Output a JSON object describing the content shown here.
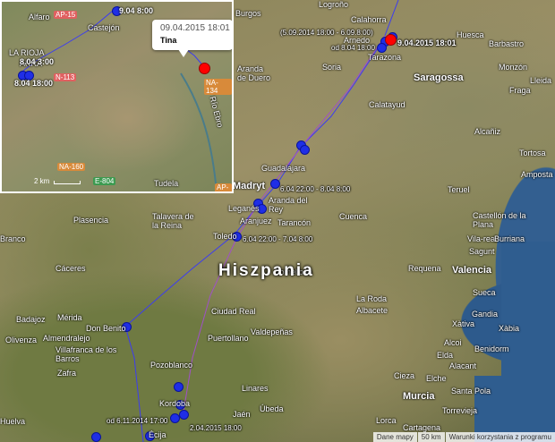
{
  "map": {
    "country_label": "Hiszpania",
    "cities": [
      {
        "name": "Burgos"
      },
      {
        "name": "Logroño"
      },
      {
        "name": "Calahorra"
      },
      {
        "name": "Arnedo"
      },
      {
        "name": "Tarazona"
      },
      {
        "name": "Huesca"
      },
      {
        "name": "Barbastro"
      },
      {
        "name": "Saragossa"
      },
      {
        "name": "Monzón"
      },
      {
        "name": "Soria"
      },
      {
        "name": "Aranda de Duero"
      },
      {
        "name": "Calatayud"
      },
      {
        "name": "Fraga"
      },
      {
        "name": "Lleida"
      },
      {
        "name": "Alcañiz"
      },
      {
        "name": "Tortosa"
      },
      {
        "name": "Amposta"
      },
      {
        "name": "Guadalajara"
      },
      {
        "name": "Madryt"
      },
      {
        "name": "Aranda del Rey"
      },
      {
        "name": "Leganés"
      },
      {
        "name": "Aranjuez"
      },
      {
        "name": "Tarancón"
      },
      {
        "name": "Cuenca"
      },
      {
        "name": "Plasencia"
      },
      {
        "name": "Talavera de la Reina"
      },
      {
        "name": "Toledo"
      },
      {
        "name": "Teruel"
      },
      {
        "name": "Castellón de la Plana"
      },
      {
        "name": "Vila-real"
      },
      {
        "name": "Burriana"
      },
      {
        "name": "Sagunt"
      },
      {
        "name": "Valencia"
      },
      {
        "name": "Cáceres"
      },
      {
        "name": "Requena"
      },
      {
        "name": "Tomelloso"
      },
      {
        "name": "La Roda"
      },
      {
        "name": "Albacete"
      },
      {
        "name": "Sueca"
      },
      {
        "name": "Gandia"
      },
      {
        "name": "Xàtiva"
      },
      {
        "name": "Alcoi"
      },
      {
        "name": "Benidorm"
      },
      {
        "name": "Xàbia"
      },
      {
        "name": "Mérida"
      },
      {
        "name": "Badajoz"
      },
      {
        "name": "Olivenza"
      },
      {
        "name": "Almendralejo"
      },
      {
        "name": "Don Benito"
      },
      {
        "name": "Ciudad Real"
      },
      {
        "name": "Puertollano"
      },
      {
        "name": "Valdepeñas"
      },
      {
        "name": "Villafranca de los Barros"
      },
      {
        "name": "Zafra"
      },
      {
        "name": "Pozoblanco"
      },
      {
        "name": "Linares"
      },
      {
        "name": "Jaén"
      },
      {
        "name": "Úbeda"
      },
      {
        "name": "Elda"
      },
      {
        "name": "Alacant"
      },
      {
        "name": "Elche"
      },
      {
        "name": "Santa Pola"
      },
      {
        "name": "Torrevieja"
      },
      {
        "name": "Murcia"
      },
      {
        "name": "Cieza"
      },
      {
        "name": "Lorca"
      },
      {
        "name": "Cartagena"
      },
      {
        "name": "Kordoba"
      },
      {
        "name": "Écija"
      },
      {
        "name": "Branco"
      },
      {
        "name": "Huelva"
      }
    ],
    "annotations": [
      {
        "text": "(5.09.2014 18:00 - 6.09.8:00)"
      },
      {
        "text": "od 8.04 18:00"
      },
      {
        "text": "9.04.2015 18:01"
      },
      {
        "text": "6.04 22:00 - 8.04 8:00"
      },
      {
        "text": "6.04 22:00 - 7.04 8:00"
      },
      {
        "text": "od 6.11.2014 17:00"
      },
      {
        "text": "2.04.2015 18:00"
      }
    ],
    "inset": {
      "labels": [
        {
          "text": "Alfaro"
        },
        {
          "text": "Castejón"
        },
        {
          "text": "9.04 8:00"
        },
        {
          "text": "LA RIOJA"
        },
        {
          "text": "ARRA"
        },
        {
          "text": "8.04 3:00"
        },
        {
          "text": "8.04 18:00"
        },
        {
          "text": "Río Ebro"
        },
        {
          "text": "Tudela"
        }
      ],
      "roads": [
        {
          "text": "AP-15",
          "color": "#e06060"
        },
        {
          "text": "N-113",
          "color": "#e06060"
        },
        {
          "text": "NA-134",
          "color": "#d88a3a"
        },
        {
          "text": "NA-160",
          "color": "#d88a3a"
        },
        {
          "text": "E-804",
          "color": "#3c9a50"
        },
        {
          "text": "AP-68",
          "color": "#d88a3a"
        }
      ],
      "scale": "2 km",
      "popup": {
        "date": "09.04.2015 18:01",
        "name": "Tina"
      }
    },
    "footer": {
      "data_label": "Dane mapy",
      "scale": "50 km",
      "terms": "Warunki korzystania z programu"
    },
    "logo": "Google",
    "colors": {
      "track_blue": "#1f2ee6",
      "track_purple": "#a050c8",
      "marker_red": "#ff0000"
    }
  }
}
